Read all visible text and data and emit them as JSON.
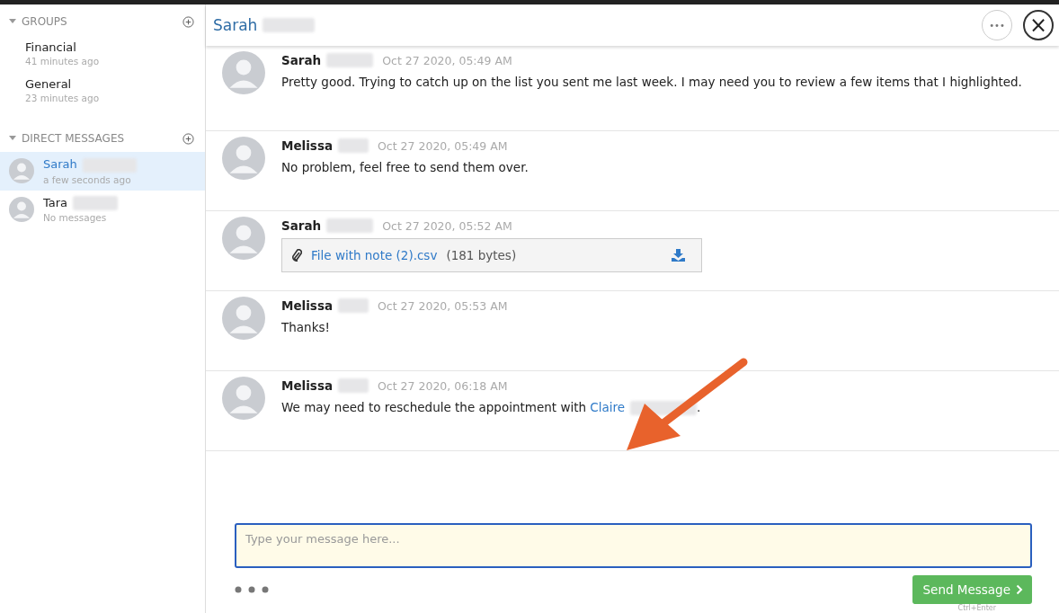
{
  "sidebar": {
    "sections": [
      {
        "title": "GROUPS",
        "expanded": true,
        "items": [
          {
            "name": "Financial",
            "subtitle": "41 minutes ago",
            "selected": false,
            "avatar": false
          },
          {
            "name": "General",
            "subtitle": "23 minutes ago",
            "selected": false,
            "avatar": false
          }
        ]
      },
      {
        "title": "DIRECT MESSAGES",
        "expanded": true,
        "items": [
          {
            "name": "Sarah",
            "subtitle": "a few seconds ago",
            "selected": true,
            "avatar": true
          },
          {
            "name": "Tara",
            "subtitle": "No messages",
            "selected": false,
            "avatar": true
          }
        ]
      }
    ]
  },
  "header": {
    "title": "Sarah",
    "more_button": "•••",
    "close_button": "×"
  },
  "messages": [
    {
      "kind": "text",
      "sender": "Sarah",
      "time": "Oct 27 2020, 05:49 AM",
      "text": "Pretty good. Trying to catch up on the list you sent me last week. I may need you to review a few items that I highlighted."
    },
    {
      "kind": "text",
      "sender": "Melissa",
      "time": "Oct 27 2020, 05:49 AM",
      "text": "No problem, feel free to send them over."
    },
    {
      "kind": "file",
      "sender": "Sarah",
      "time": "Oct 27 2020, 05:52 AM",
      "file_name": "File with note (2).csv",
      "file_size": "(181 bytes)"
    },
    {
      "kind": "text",
      "sender": "Melissa",
      "time": "Oct 27 2020, 05:53 AM",
      "text": "Thanks!"
    },
    {
      "kind": "mention",
      "sender": "Melissa",
      "time": "Oct 27 2020, 06:18 AM",
      "text": "We may need to reschedule the appointment with ",
      "mention": "Claire",
      "text_after": "."
    }
  ],
  "composer": {
    "placeholder": "Type your message here...",
    "send_button": "Send Message",
    "shortcut": "Ctrl+Enter"
  }
}
